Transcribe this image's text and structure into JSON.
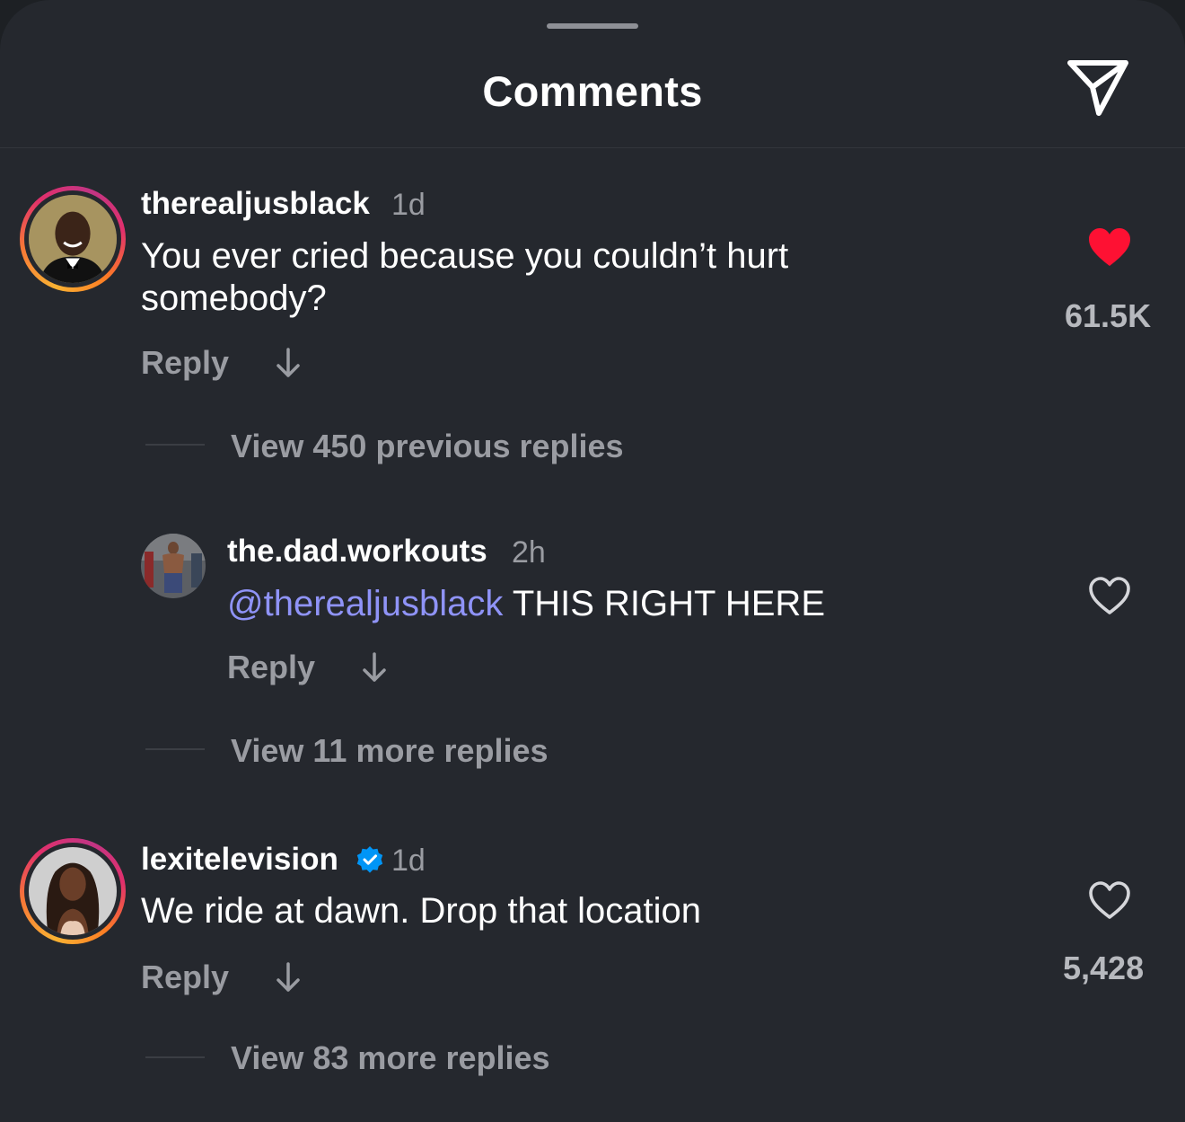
{
  "header": {
    "title": "Comments"
  },
  "colors": {
    "background": "#25282e",
    "mention": "#8f93f7",
    "liked_heart": "#fe1133",
    "verified_badge": "#0095f6"
  },
  "comments": [
    {
      "username": "therealjusblack",
      "time": "1d",
      "text_line1": "You ever cried because you couldn’t hurt",
      "text_line2": "somebody?",
      "reply_label": "Reply",
      "likes": "61.5K",
      "liked": true,
      "view_replies": "View 450 previous replies",
      "avatar_icon": "profile-photo-man-in-tuxedo"
    },
    {
      "username": "the.dad.workouts",
      "time": "2h",
      "mention": "@therealjusblack",
      "text": " THIS RIGHT HERE",
      "reply_label": "Reply",
      "liked": false,
      "view_replies": "View 11 more replies",
      "avatar_icon": "profile-photo-man-in-gym"
    },
    {
      "username": "lexitelevision",
      "verified": true,
      "time": "1d",
      "text": "We ride at dawn. Drop that location",
      "reply_label": "Reply",
      "likes": "5,428",
      "liked": false,
      "view_replies": "View 83 more replies",
      "avatar_icon": "profile-photo-woman"
    }
  ]
}
